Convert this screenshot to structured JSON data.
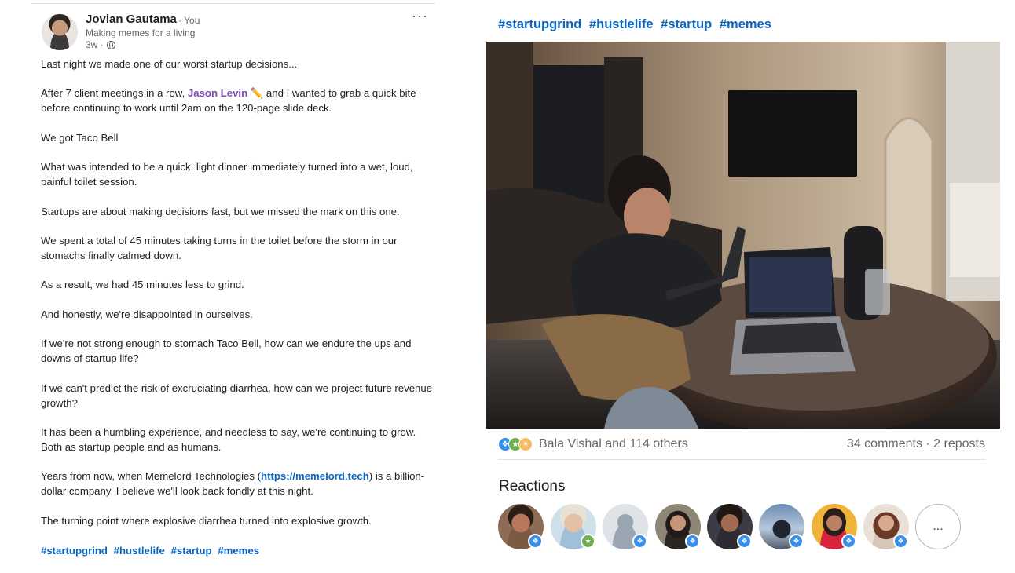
{
  "post": {
    "author": {
      "name": "Jovian Gautama",
      "you_label": "· You",
      "tagline": "Making memes for a living",
      "time": "3w ·"
    },
    "more_label": "···",
    "paragraphs": {
      "p1": "Last night we made one of our worst startup decisions...",
      "p2_before": "After 7 client meetings in a row, ",
      "p2_mention": "Jason Levin",
      "p2_emoji": "✏️",
      "p2_after": " and I wanted to grab a quick bite before continuing to work until 2am on the 120-page slide deck.",
      "p3": "We got Taco Bell",
      "p4": "What was intended to be a quick, light dinner immediately turned into a wet, loud, painful toilet session.",
      "p5": "Startups are about making decisions fast, but we missed the mark on this one.",
      "p6": "We spent a total of 45 minutes taking turns in the toilet before the storm in our stomachs finally calmed down.",
      "p7": "As a result, we had 45 minutes less to grind.",
      "p8": "And honestly, we're disappointed in ourselves.",
      "p9": "If we're not strong enough to stomach Taco Bell, how can we endure the ups and downs of startup life?",
      "p10": "If we can't predict the risk of excruciating diarrhea, how can we project future revenue growth?",
      "p11": "It has been a humbling experience, and needless to say, we're continuing to grow. Both as startup people and as humans.",
      "p12_before": "Years from now, when Memelord Technologies (",
      "p12_link": "https://memelord.tech",
      "p12_after": ") is a billion-dollar company, I believe we'll look back fondly at this night.",
      "p13": "The turning point where explosive diarrhea turned into explosive growth."
    },
    "hashtags": [
      "#startupgrind",
      "#hustlelife",
      "#startup",
      "#memes"
    ]
  },
  "panel": {
    "hashtags": [
      "#startupgrind",
      "#hustlelife",
      "#startup",
      "#memes"
    ],
    "social": {
      "reactors_text": "Bala Vishal and 114 others",
      "comments_reposts": "34 comments · 2 reposts",
      "reaction_icons": [
        "like-icon",
        "celebrate-icon",
        "insightful-icon"
      ]
    },
    "reactions_title": "Reactions",
    "more_label": "...",
    "colors": {
      "link_blue": "#0a66c2",
      "mention_purple": "#7a4bb4",
      "like_blue": "#378fe9",
      "celebrate_green": "#6dae4f",
      "insightful_yellow": "#f5bb5c"
    }
  }
}
